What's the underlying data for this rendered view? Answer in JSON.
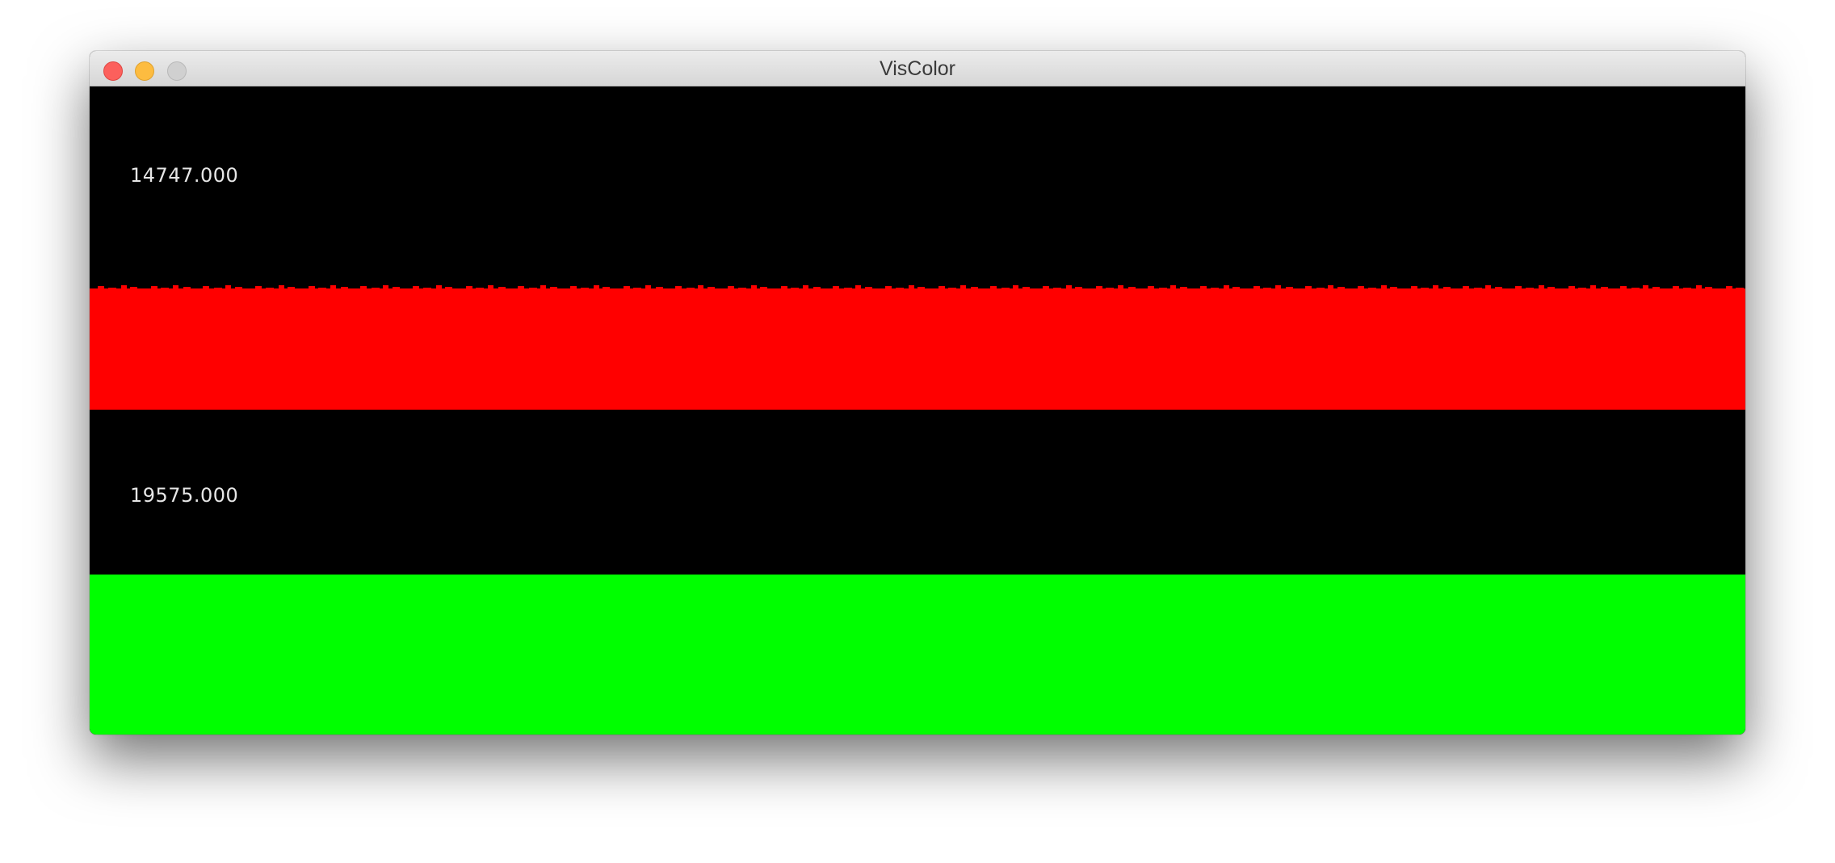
{
  "window": {
    "title": "VisColor"
  },
  "panels": [
    {
      "label": "14747.000",
      "bar_color": "#ff0000",
      "background": "#000000"
    },
    {
      "label": "19575.000",
      "bar_color": "#00ff00",
      "background": "#000000"
    }
  ],
  "icons": {
    "close": "close-button",
    "minimize": "minimize-button",
    "zoom": "zoom-button"
  },
  "colors": {
    "traffic_close": "#fc605c",
    "traffic_minimize": "#fdbc40",
    "traffic_zoom_disabled": "#d0d0d0"
  }
}
